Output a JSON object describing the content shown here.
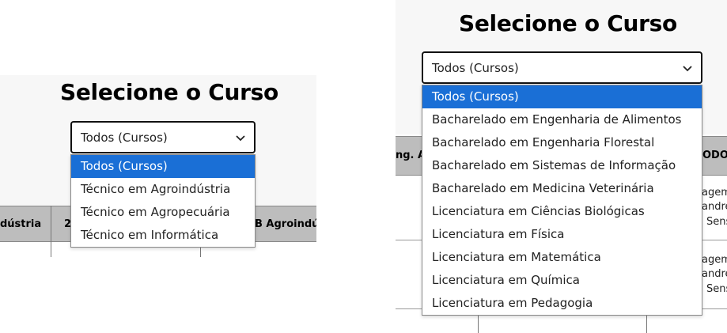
{
  "left": {
    "title": "Selecione o Curso",
    "selected": "Todos (Cursos)",
    "options": [
      "Todos (Cursos)",
      "Técnico em Agroindústria",
      "Técnico em Agropecuária",
      "Técnico em Informática"
    ],
    "headers": [
      "dústria",
      "2",
      "B Agroindús"
    ]
  },
  "right": {
    "title": "Selecione o Curso",
    "selected": "Todos (Cursos)",
    "options": [
      "Todos (Cursos)",
      "Bacharelado em Engenharia de Alimentos",
      "Bacharelado em Engenharia Florestal",
      "Bacharelado em Sistemas de Informação",
      "Bacharelado em Medicina Veterinária",
      "Licenciatura em Ciências Biológicas",
      "Licenciatura em Física",
      "Licenciatura em Matemática",
      "Licenciatura em Química",
      "Licenciatura em Pedagogia"
    ],
    "headers": [
      "ng. A",
      "ODO I"
    ],
    "cells": [
      "agem",
      "andre",
      "Sens",
      "agem",
      "andre",
      "Sens"
    ]
  },
  "colors": {
    "highlight": "#1a6fd6",
    "header_bg": "#bdbdbd",
    "page_bg": "#f7f7f7"
  },
  "icons": {
    "dropdown": "chevron-down-icon"
  }
}
